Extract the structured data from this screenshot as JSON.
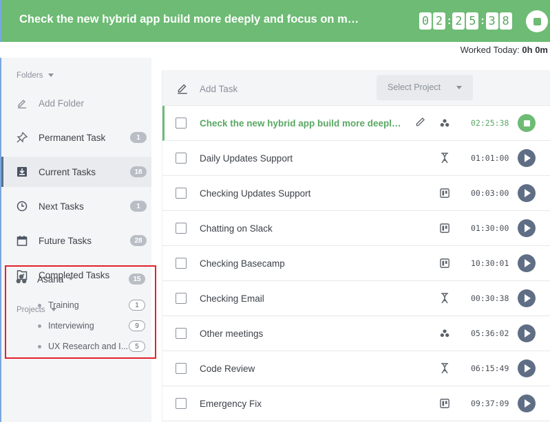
{
  "header": {
    "title": "Check the new hybrid app build more deeply and focus on major pr...",
    "timer_digits": [
      "0",
      "2",
      "2",
      "5",
      "3",
      "8"
    ],
    "colon": ":",
    "stop_icon": "stop-icon"
  },
  "worked_today": {
    "label": "Worked Today:",
    "value": "0h 0m"
  },
  "sidebar": {
    "folders_label": "Folders",
    "add_folder": "Add Folder",
    "items": [
      {
        "label": "Permanent Task",
        "count": "1",
        "icon": "pin-icon"
      },
      {
        "label": "Current Tasks",
        "count": "18",
        "icon": "inbox-download-icon"
      },
      {
        "label": "Next Tasks",
        "count": "1",
        "icon": "clock-icon"
      },
      {
        "label": "Future Tasks",
        "count": "28",
        "icon": "calendar-icon"
      },
      {
        "label": "Completed Tasks",
        "count": "",
        "icon": "check-folder-icon"
      }
    ],
    "projects_label": "Projects",
    "project": {
      "name": "Asana",
      "count": "15",
      "icon": "asana-icon",
      "children": [
        {
          "label": "Training",
          "count": "1"
        },
        {
          "label": "Interviewing",
          "count": "9"
        },
        {
          "label": "UX Research and I...",
          "count": "5"
        }
      ]
    }
  },
  "toolbar": {
    "add_task": "Add Task",
    "select_project": "Select Project"
  },
  "accent": {
    "green": "#6dbb74",
    "slate": "#5f6e85",
    "highlight_red": "#e3202a"
  },
  "tasks": [
    {
      "name": "Check the new hybrid app build more deeply and f...",
      "duration": "02:25:38",
      "icon": "asana-icon",
      "running": true
    },
    {
      "name": "Daily Updates Support",
      "duration": "01:01:00",
      "icon": "jira-icon",
      "running": false
    },
    {
      "name": "Checking Updates Support",
      "duration": "00:03:00",
      "icon": "trello-icon",
      "running": false
    },
    {
      "name": "Chatting on Slack",
      "duration": "01:30:00",
      "icon": "trello-icon",
      "running": false
    },
    {
      "name": "Checking Basecamp",
      "duration": "10:30:01",
      "icon": "trello-icon",
      "running": false
    },
    {
      "name": "Checking Email",
      "duration": "00:30:38",
      "icon": "jira-icon",
      "running": false
    },
    {
      "name": "Other meetings",
      "duration": "05:36:02",
      "icon": "asana-icon",
      "running": false
    },
    {
      "name": "Code Review",
      "duration": "06:15:49",
      "icon": "jira-icon",
      "running": false
    },
    {
      "name": "Emergency Fix",
      "duration": "09:37:09",
      "icon": "trello-icon",
      "running": false
    }
  ]
}
